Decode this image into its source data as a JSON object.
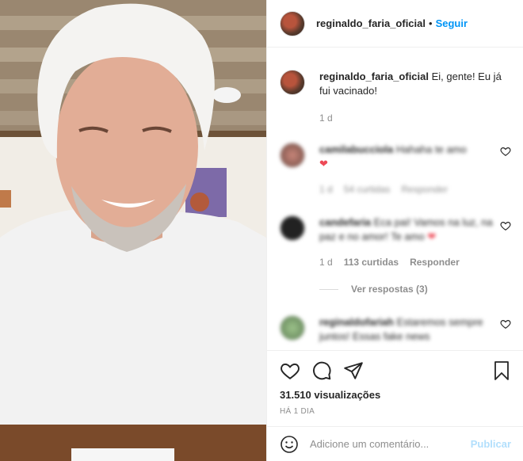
{
  "post": {
    "username": "reginaldo_faria_oficial",
    "follow_label": "Seguir",
    "separator": "•",
    "caption": "Ei, gente! Eu já fui vacinado!",
    "caption_age": "1 d"
  },
  "comments": [
    {
      "username": "camilabucciola",
      "text": "Hahaha te amo",
      "age": "1 d",
      "likes": "54 curtidas",
      "reply_label": "Responder"
    },
    {
      "username": "candefaria",
      "text": "Eca pai! Vamos na luz, na paz e no amor! Te amo",
      "age": "1 d",
      "likes": "113 curtidas",
      "reply_label": "Responder",
      "view_replies": "Ver respostas (3)"
    },
    {
      "username": "reginaldofariah",
      "text": "Estaremos sempre juntos! Essas fake news"
    }
  ],
  "actions": {
    "views": "31.510 visualizações",
    "posted_ago": "HÁ 1 DIA"
  },
  "add_comment": {
    "placeholder": "Adicione um comentário...",
    "publish_label": "Publicar"
  },
  "icons": [
    "heart-icon",
    "comment-icon",
    "share-icon",
    "bookmark-icon",
    "emoji-icon"
  ],
  "colors": {
    "accent": "#0095f6",
    "like_red": "#ed4956",
    "publish_disabled": "#b2dffc"
  }
}
